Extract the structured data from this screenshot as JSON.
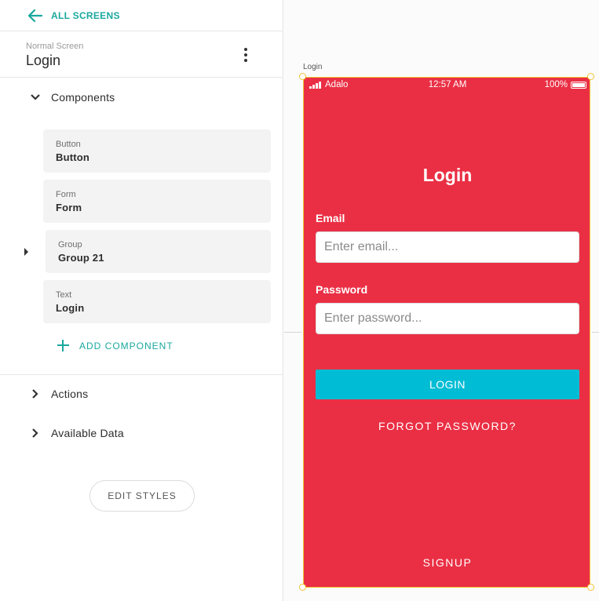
{
  "nav": {
    "back_label": "ALL SCREENS"
  },
  "screen": {
    "type": "Normal Screen",
    "name": "Login"
  },
  "sections": {
    "components_label": "Components",
    "actions_label": "Actions",
    "available_data_label": "Available Data"
  },
  "components": [
    {
      "type": "Button",
      "name": "Button"
    },
    {
      "type": "Form",
      "name": "Form"
    },
    {
      "type": "Group",
      "name": "Group 21"
    },
    {
      "type": "Text",
      "name": "Login"
    }
  ],
  "add_component_label": "ADD COMPONENT",
  "edit_styles_label": "EDIT STYLES",
  "canvas": {
    "frame_label": "Login",
    "status_bar": {
      "carrier": "Adalo",
      "time": "12:57 AM",
      "battery": "100%"
    },
    "title": "Login",
    "email_label": "Email",
    "email_placeholder": "Enter email...",
    "password_label": "Password",
    "password_placeholder": "Enter password...",
    "login_button": "LOGIN",
    "forgot_link": "FORGOT PASSWORD?",
    "signup_link": "SIGNUP"
  },
  "colors": {
    "accent": "#1aa89f",
    "screen_background": "#ea2f44",
    "button": "#00bcd4",
    "selection": "#f2c234"
  }
}
